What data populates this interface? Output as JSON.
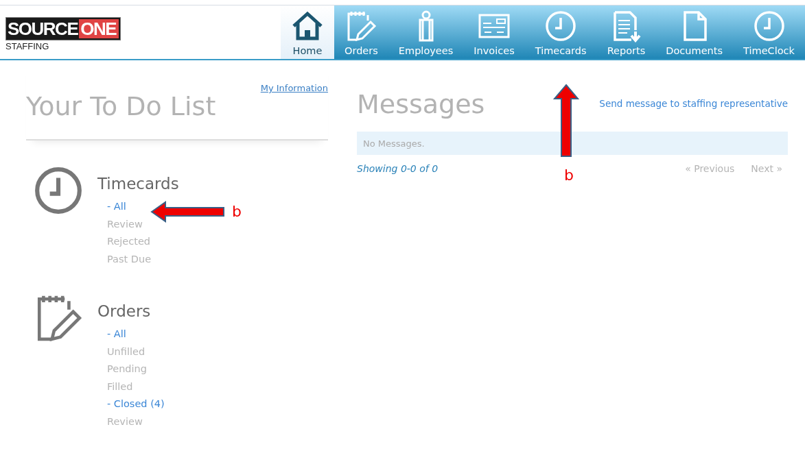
{
  "logo": {
    "brand_first": "SOURCE",
    "brand_second": "ONE",
    "tagline": "STAFFING"
  },
  "nav": [
    {
      "label": "Home",
      "kind": "home",
      "selected": true
    },
    {
      "label": "Orders",
      "kind": "notepad",
      "selected": false
    },
    {
      "label": "Employees",
      "kind": "person",
      "selected": false
    },
    {
      "label": "Invoices",
      "kind": "invoice",
      "selected": false
    },
    {
      "label": "Timecards",
      "kind": "clock",
      "selected": false
    },
    {
      "label": "Reports",
      "kind": "report",
      "selected": false
    },
    {
      "label": "Documents",
      "kind": "document",
      "selected": false
    },
    {
      "label": "TimeClock",
      "kind": "clock",
      "selected": false
    }
  ],
  "todo": {
    "title": "Your To Do List",
    "link": "My Information",
    "sections": [
      {
        "title": "Timecards",
        "kind": "clock",
        "items": [
          {
            "label": "- All",
            "active": true
          },
          {
            "label": "Review",
            "active": false
          },
          {
            "label": "Rejected",
            "active": false
          },
          {
            "label": "Past Due",
            "active": false
          }
        ]
      },
      {
        "title": "Orders",
        "kind": "notepad",
        "items": [
          {
            "label": "- All",
            "active": true
          },
          {
            "label": "Unfilled",
            "active": false
          },
          {
            "label": "Pending",
            "active": false
          },
          {
            "label": "Filled",
            "active": false
          },
          {
            "label": "- Closed (4)",
            "active": true
          },
          {
            "label": "Review",
            "active": false
          }
        ]
      }
    ]
  },
  "messages": {
    "title": "Messages",
    "link": "Send message to staffing representative",
    "empty_text": "No Messages.",
    "showing": "Showing 0-0 of 0",
    "previous": "« Previous",
    "next": "Next »"
  },
  "annotations": [
    {
      "kind": "left",
      "label": "b"
    },
    {
      "kind": "up",
      "label": "b"
    }
  ]
}
